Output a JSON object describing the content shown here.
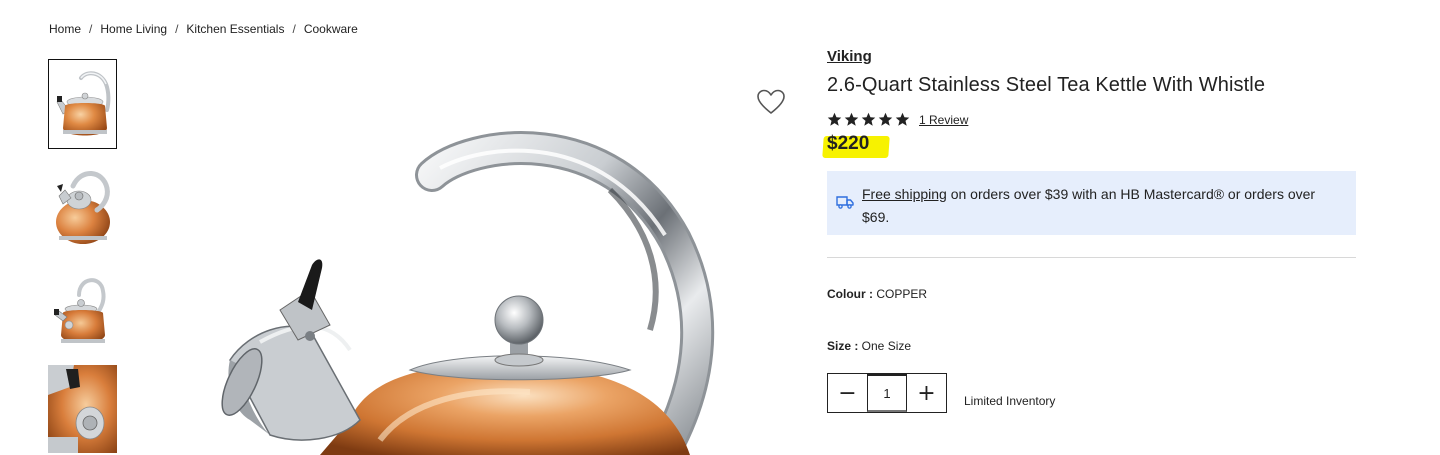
{
  "breadcrumb": {
    "items": [
      "Home",
      "Home Living",
      "Kitchen Essentials",
      "Cookware"
    ],
    "separator": "/"
  },
  "gallery": {
    "thumbnails": [
      "kettle-front",
      "kettle-top",
      "kettle-side",
      "kettle-spout-detail"
    ],
    "active_index": 0,
    "main_image": "kettle-closeup"
  },
  "product": {
    "brand": "Viking",
    "title": "2.6-Quart Stainless Steel Tea Kettle With Whistle",
    "rating": 5,
    "rating_max": 5,
    "reviews_label": "1 Review",
    "price": "$220",
    "price_highlight_color": "#f7f200"
  },
  "shipping": {
    "link_text": "Free shipping",
    "text": " on orders over $39 with an HB Mastercard® or orders over $69.",
    "icon": "truck-icon",
    "background": "#e6eefc",
    "icon_color": "#2f6fde"
  },
  "options": {
    "colour_label": "Colour :",
    "colour_value": " COPPER",
    "size_label": "Size :",
    "size_value": " One Size"
  },
  "quantity": {
    "value": "1",
    "minus": "−",
    "plus": "+",
    "inventory_text": "Limited Inventory"
  },
  "wishlist": {
    "icon": "heart-icon"
  }
}
